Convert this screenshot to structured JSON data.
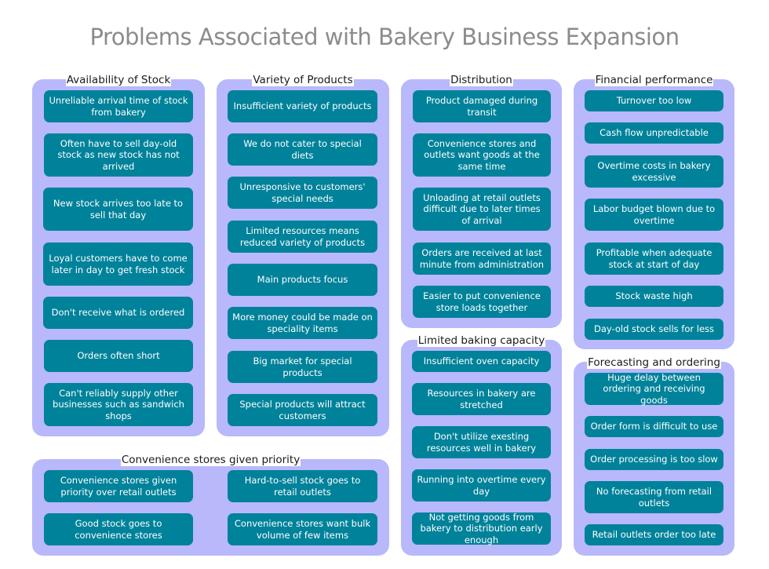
{
  "title": "Problems Associated with Bakery Business Expansion",
  "colors": {
    "title": "#8c8c8c",
    "group_fill": "#b8b8fb",
    "item_fill": "#00829a",
    "item_text": "#ffffff"
  },
  "groups": [
    {
      "label": "Availability of Stock",
      "items": [
        "Unreliable arrival time of stock from bakery",
        "Often have to sell day-old stock as new stock has not arrived",
        "New stock arrives too late to sell that day",
        "Loyal customers have to come later in day to get fresh stock",
        "Don't receive what is ordered",
        "Orders often short",
        "Can't reliably supply other businesses such as sandwich shops"
      ]
    },
    {
      "label": "Variety of Products",
      "items": [
        "Insufficient variety of products",
        "We do not cater to special diets",
        "Unresponsive to customers' special needs",
        "Limited resources means reduced variety of products",
        "Main products focus",
        "More money could be made on speciality items",
        "Big market for special products",
        "Special products will attract customers"
      ]
    },
    {
      "label": "Distribution",
      "items": [
        "Product damaged during transit",
        "Convenience stores and outlets want goods at the same time",
        "Unloading at retail outlets difficult due to later times of arrival",
        "Orders are received at last minute from administration",
        "Easier to put convenience store loads together"
      ]
    },
    {
      "label": "Limited baking capacity",
      "items": [
        "Insufficient oven capacity",
        "Resources in bakery are stretched",
        "Don't utilize exesting resources well in bakery",
        "Running into overtime every day",
        "Not getting goods from bakery to distribution early enough"
      ]
    },
    {
      "label": "Financial performance",
      "items": [
        "Turnover too low",
        "Cash flow unpredictable",
        "Overtime costs in bakery excessive",
        "Labor budget blown due to overtime",
        "Profitable when adequate stock at start of day",
        "Stock waste high",
        "Day-old stock sells for less"
      ]
    },
    {
      "label": "Forecasting and ordering",
      "items": [
        "Huge delay between ordering and receiving goods",
        "Order form is difficult to use",
        "Order processing is too slow",
        "No forecasting from retail outlets",
        "Retail outlets order too late"
      ]
    },
    {
      "label": "Convenience stores given priority",
      "items": [
        "Convenience stores given priority over retail outlets",
        "Hard-to-sell stock goes to retail outlets",
        "Good stock goes to convenience stores",
        "Convenience stores want bulk volume of few items"
      ]
    }
  ]
}
